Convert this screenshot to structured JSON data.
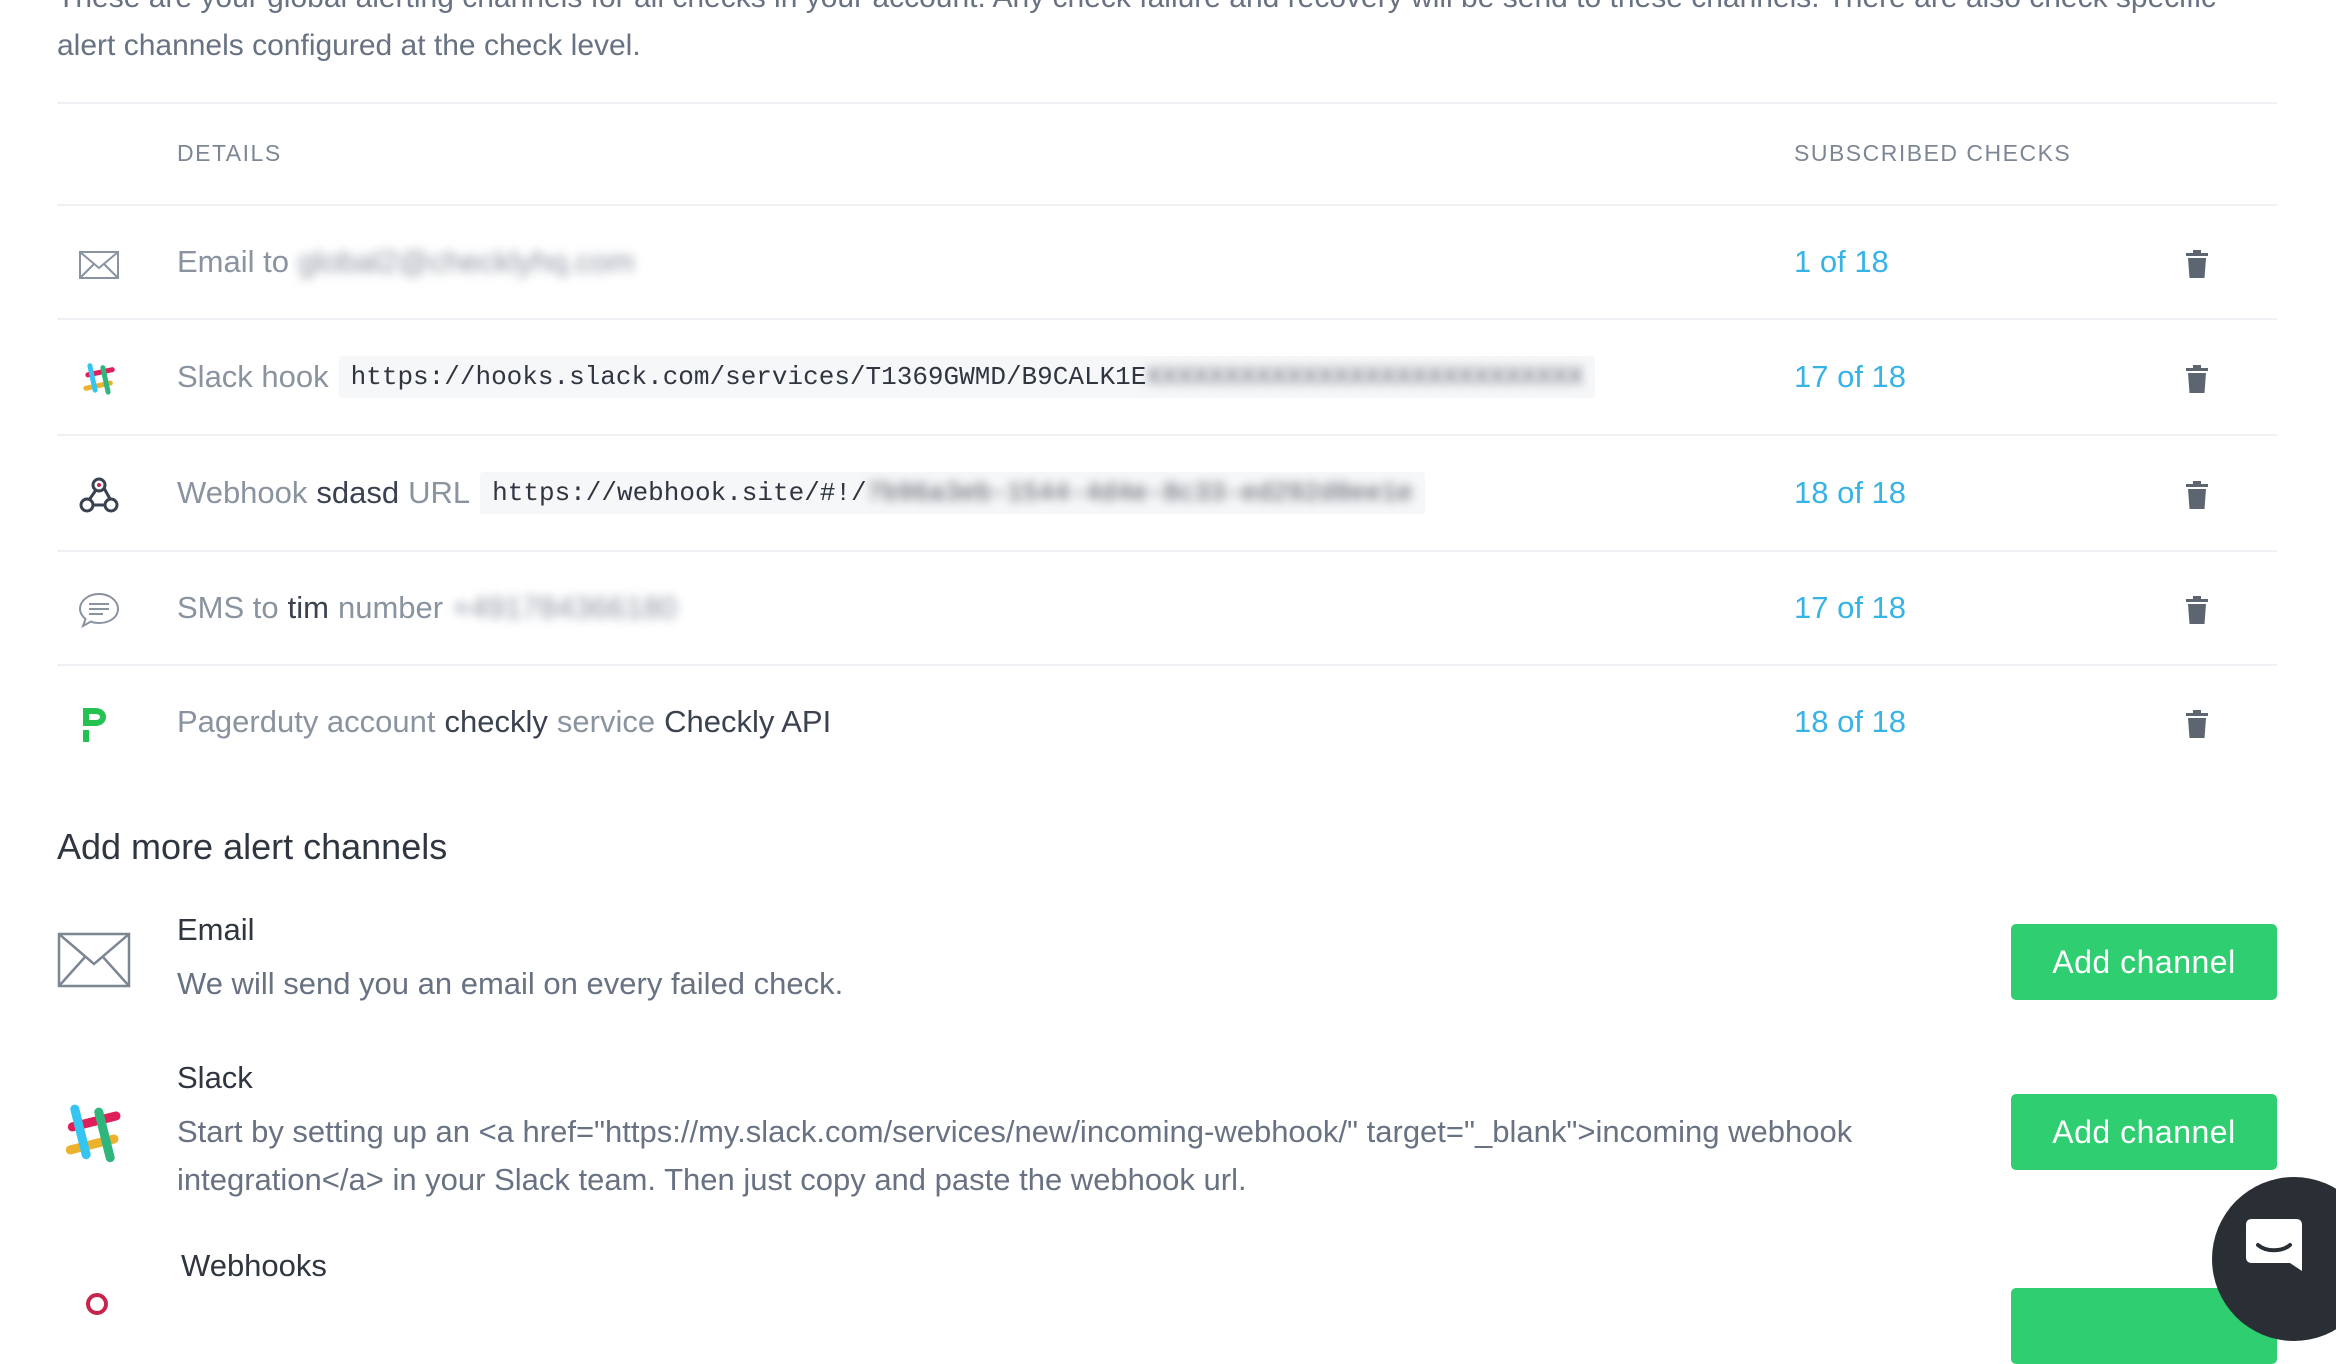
{
  "intro": {
    "line1": "These are your global alerting channels for all checks in your account. Any check failure and recovery will be send to these channels. There are also check specific",
    "line2": "alert channels configured at the check level."
  },
  "table": {
    "details_header": "DETAILS",
    "subscribed_header": "SUBSCRIBED CHECKS",
    "rows": [
      {
        "type": "email",
        "icon": "envelope-icon",
        "label": "Email to",
        "value": "global2@checklyhq.com",
        "count": "1 of 18"
      },
      {
        "type": "slack",
        "icon": "slack-icon",
        "label": "Slack hook",
        "url_visible": "https://hooks.slack.com/services/T1369GWMD/B9CALK1E",
        "url_hidden": "XXXXXXXXXXXXXXXXXXXXXXXXXXXX",
        "count": "17 of 18"
      },
      {
        "type": "webhook",
        "icon": "webhook-icon",
        "label": "Webhook",
        "name": "sdasd",
        "url_label": "URL",
        "url_visible": "https://webhook.site/#!/",
        "url_hidden": "7b96a3eb-1544-4d4e-8c33-ed292d8ee1e",
        "count": "18 of 18"
      },
      {
        "type": "sms",
        "icon": "sms-bubble-icon",
        "label": "SMS to",
        "name": "tim",
        "number_label": "number",
        "number": "+491784366180",
        "count": "17 of 18"
      },
      {
        "type": "pagerduty",
        "icon": "pagerduty-icon",
        "label": "Pagerduty account",
        "account": "checkly",
        "service_label": "service",
        "service": "Checkly API",
        "count": "18 of 18"
      }
    ]
  },
  "add_section": {
    "title": "Add more alert channels",
    "button_label": "Add channel",
    "items": [
      {
        "name": "Email",
        "icon": "envelope-icon",
        "description": "We will send you an email on every failed check."
      },
      {
        "name": "Slack",
        "icon": "slack-icon",
        "description_line1": "Start by setting up an <a href=\"https://my.slack.com/services/new/incoming-webhook/\" target=\"_blank\">incoming webhook",
        "description_line2": "integration</a> in your Slack team. Then just copy and paste the webhook url."
      },
      {
        "name": "Webhooks",
        "icon": "webhook-icon"
      }
    ]
  },
  "colors": {
    "accent_blue": "#37b3e6",
    "button_green": "#2fce70",
    "pagerduty_green": "#25c151"
  }
}
